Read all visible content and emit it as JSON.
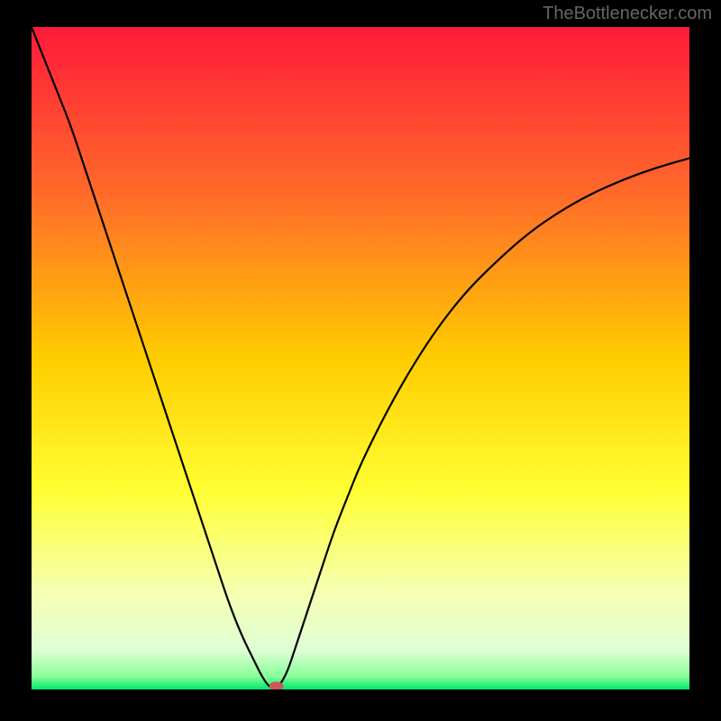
{
  "watermark": "TheBottlenecker.com",
  "chart_data": {
    "type": "line",
    "title": "",
    "xlabel": "",
    "ylabel": "",
    "xlim": [
      0,
      100
    ],
    "ylim": [
      0,
      100
    ],
    "background_gradient": {
      "stops": [
        {
          "offset": 0,
          "color": "#ff1a3a"
        },
        {
          "offset": 25,
          "color": "#ff6a2a"
        },
        {
          "offset": 50,
          "color": "#ffcc00"
        },
        {
          "offset": 70,
          "color": "#ffff33"
        },
        {
          "offset": 85,
          "color": "#f5ffb0"
        },
        {
          "offset": 94,
          "color": "#e0ffd5"
        },
        {
          "offset": 98,
          "color": "#8aff9a"
        },
        {
          "offset": 100,
          "color": "#00e86b"
        }
      ]
    },
    "series": [
      {
        "name": "bottleneck-curve",
        "color": "#000000",
        "width": 2.2,
        "x": [
          0,
          2,
          4,
          6,
          8,
          10,
          12,
          14,
          16,
          18,
          20,
          22,
          24,
          26,
          28,
          30,
          32,
          34,
          35,
          36,
          37,
          38,
          39,
          40,
          42,
          44,
          46,
          48,
          50,
          54,
          58,
          62,
          66,
          70,
          75,
          80,
          85,
          90,
          95,
          100
        ],
        "y": [
          100,
          95,
          90,
          85,
          79,
          73,
          67,
          61,
          55,
          49,
          43,
          37,
          31,
          25,
          19,
          13,
          8,
          4,
          2,
          0.5,
          0,
          1,
          3,
          6,
          12,
          18,
          24,
          29,
          34,
          42,
          49,
          55,
          60,
          64,
          68.5,
          72,
          74.8,
          77,
          78.8,
          80.2
        ]
      }
    ],
    "marker": {
      "x": 37.2,
      "y": 0.5,
      "color": "#c85a5a",
      "rx": 8,
      "ry": 5
    }
  }
}
